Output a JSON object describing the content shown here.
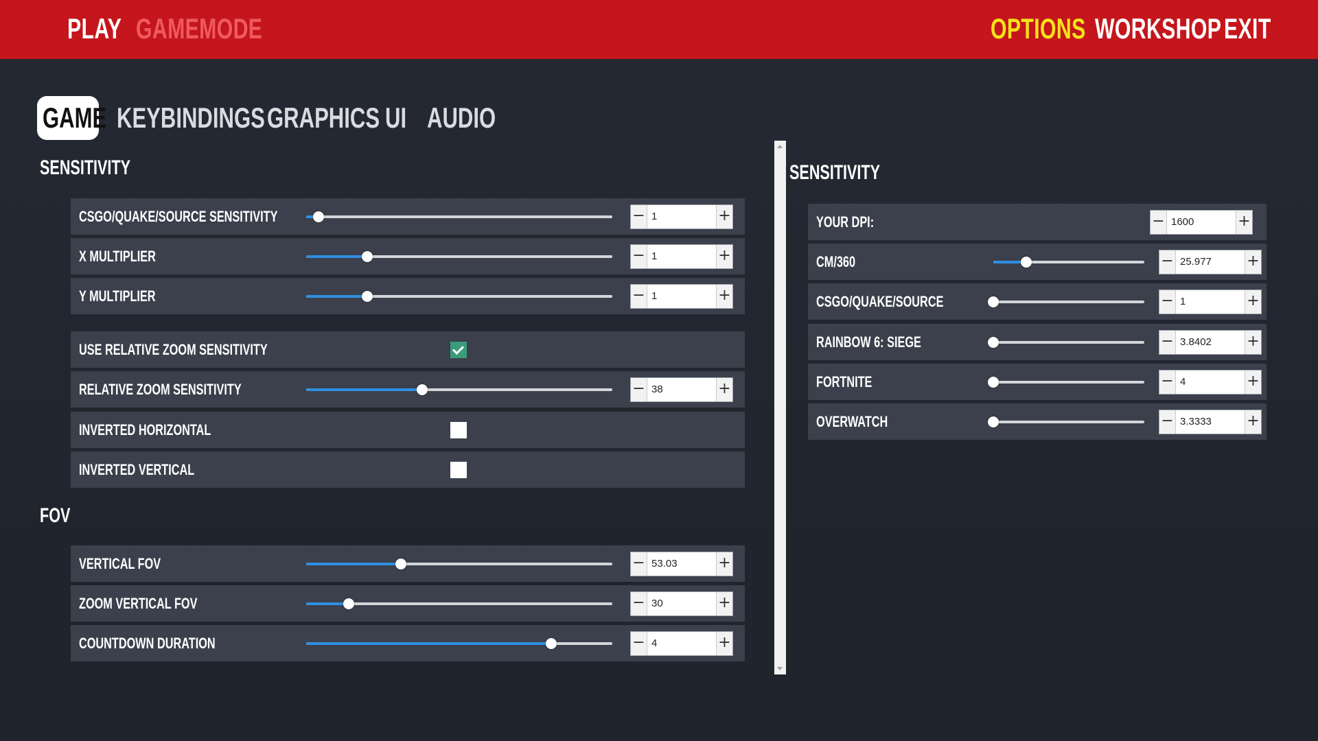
{
  "topnav": {
    "play": "PLAY",
    "gamemode": "GAMEMODE",
    "options": "OPTIONS",
    "workshop": "WORKSHOP",
    "exit": "EXIT"
  },
  "tabs": [
    "GAME",
    "KEYBINDINGS",
    "GRAPHICS",
    "UI",
    "AUDIO"
  ],
  "active_tab": "GAME",
  "left": {
    "sensitivity_title": "SENSITIVITY",
    "fov_title": "FOV",
    "rows": {
      "csgo_sens": {
        "label": "CSGO/QUAKE/SOURCE SENSITIVITY",
        "value": "1",
        "slider_fraction": 0.04
      },
      "x_mult": {
        "label": "X MULTIPLIER",
        "value": "1",
        "slider_fraction": 0.2
      },
      "y_mult": {
        "label": "Y MULTIPLIER",
        "value": "1",
        "slider_fraction": 0.2
      },
      "use_rel_zoom": {
        "label": "USE RELATIVE ZOOM SENSITIVITY",
        "checked": true
      },
      "rel_zoom": {
        "label": "RELATIVE ZOOM SENSITIVITY",
        "value": "38",
        "slider_fraction": 0.38
      },
      "inv_h": {
        "label": "INVERTED HORIZONTAL",
        "checked": false
      },
      "inv_v": {
        "label": "INVERTED VERTICAL",
        "checked": false
      },
      "vfov": {
        "label": "VERTICAL FOV",
        "value": "53.03",
        "slider_fraction": 0.31
      },
      "zoom_vfov": {
        "label": "ZOOM VERTICAL FOV",
        "value": "30",
        "slider_fraction": 0.14
      },
      "countdown": {
        "label": "COUNTDOWN DURATION",
        "value": "4",
        "slider_fraction": 0.8
      }
    }
  },
  "right": {
    "sensitivity_title": "SENSITIVITY",
    "rows": {
      "dpi": {
        "label": "YOUR DPI:",
        "value": "1600"
      },
      "cm360": {
        "label": "CM/360",
        "value": "25.977",
        "slider_fraction": 0.22
      },
      "csgo": {
        "label": "CSGO/QUAKE/SOURCE",
        "value": "1",
        "slider_fraction": 0.0
      },
      "r6": {
        "label": "RAINBOW 6: SIEGE",
        "value": "3.8402",
        "slider_fraction": 0.0
      },
      "fortnite": {
        "label": "FORTNITE",
        "value": "4",
        "slider_fraction": 0.0
      },
      "overwatch": {
        "label": "OVERWATCH",
        "value": "3.3333",
        "slider_fraction": 0.0
      }
    }
  },
  "colors": {
    "topbar": "#c4161c",
    "accent_options": "#f6e21c",
    "slider_fill": "#2f8fe0",
    "checkbox_checked": "#3a9c7a",
    "row_bg": "#3b404c"
  },
  "icons": {
    "minus": "minus-icon",
    "plus": "plus-icon",
    "check": "check-icon"
  }
}
